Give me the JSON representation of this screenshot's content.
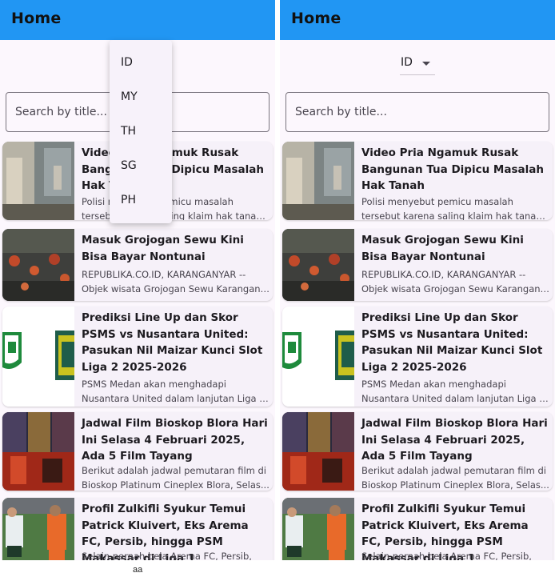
{
  "colors": {
    "app_bar": "#2196f3",
    "background": "#fcf7fd",
    "card": "#f6f1f9",
    "menu": "#f7f2fa"
  },
  "app_bar": {
    "title": "Home"
  },
  "country_dropdown": {
    "selected": "ID",
    "options": [
      "ID",
      "MY",
      "TH",
      "SG",
      "PH"
    ],
    "icon": "arrow-drop-down-icon"
  },
  "search": {
    "placeholder": "Search by title..."
  },
  "articles": [
    {
      "title": "Video Pria Ngamuk Rusak Bangunan Tua Dipicu Masalah Hak Tanah",
      "desc_lines": [
        "Polisi menyebut pemicu masalah",
        "tersebut karena saling klaim hak tanah...."
      ],
      "thumbnail": "construction-site-image"
    },
    {
      "title": "Masuk Grojogan Sewu Kini Bisa Bayar Nontunai",
      "desc_lines": [
        "REPUBLIKA.CO.ID, KARANGANYAR --",
        "Objek wisata Grojogan Sewu Karangany..."
      ],
      "thumbnail": "waterfall-crowd-image"
    },
    {
      "title": "Prediksi Line Up dan Skor PSMS vs Nusantara United: Pasukan Nil Maizar Kunci Slot Liga 2 2025-2026",
      "desc_lines": [
        "PSMS Medan akan menghadapi",
        "Nusantara United dalam lanjutan Liga 2..."
      ],
      "thumbnail": "club-crests-image"
    },
    {
      "title": "Jadwal Film Bioskop Blora Hari Ini Selasa 4 Februari 2025, Ada 5 Film Tayang",
      "desc_lines": [
        "Berikut adalah jadwal pemutaran film di",
        "Bioskop Platinum Cineplex Blora, Selas..."
      ],
      "thumbnail": "movie-poster-image"
    },
    {
      "title": "Profil Zulkifli Syukur Temui Patrick Kluivert, Eks Arema FC, Persib, hingga PSM Makassar di Liga 1",
      "desc_lines": [
        "Selain pernah bela Arema FC, Persib,"
      ],
      "thumbnail": "football-players-image"
    }
  ],
  "footer_text": "aa"
}
